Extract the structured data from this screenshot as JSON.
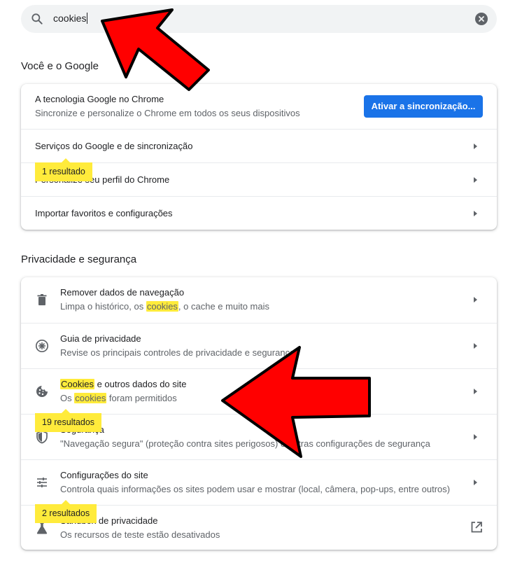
{
  "search": {
    "value": "cookies"
  },
  "sections": {
    "google": {
      "title": "Você e o Google",
      "sync_row": {
        "title": "A tecnologia Google no Chrome",
        "subtitle": "Sincronize e personalize o Chrome em todos os seus dispositivos",
        "button": "Ativar a sincronização..."
      },
      "rows": [
        {
          "title": "Serviços do Google e de sincronização"
        },
        {
          "title": "Personalize seu perfil do Chrome"
        },
        {
          "title": "Importar favoritos e configurações"
        }
      ],
      "bubble": "1 resultado"
    },
    "privacy": {
      "title": "Privacidade e segurança",
      "rows": [
        {
          "title": "Remover dados de navegação",
          "sub_a": "Limpa o histórico, os ",
          "sub_hl": "cookies",
          "sub_b": ", o cache e muito mais",
          "icon": "trash-icon"
        },
        {
          "title": "Guia de privacidade",
          "subtitle": "Revise os principais controles de privacidade e segurança",
          "icon": "compass-icon"
        },
        {
          "title_hl": "Cookies",
          "title_rest": " e outros dados do site",
          "sub_a": "Os ",
          "sub_hl": "cookies",
          "sub_b": " foram permitidos",
          "icon": "cookie-icon"
        },
        {
          "title": "Segurança",
          "subtitle": "\"Navegação segura\" (proteção contra sites perigosos) e outras configurações de segurança",
          "icon": "shield-icon"
        },
        {
          "title": "Configurações do site",
          "subtitle": "Controla quais informações os sites podem usar e mostrar (local, câmera, pop-ups, entre outros)",
          "icon": "tune-icon"
        },
        {
          "title": "Sandbox de privacidade",
          "subtitle": "Os recursos de teste estão desativados",
          "icon": "flask-icon",
          "trailing_icon": "open-in-new-icon"
        }
      ],
      "bubble_cookies": "19 resultados",
      "bubble_site": "2 resultados"
    }
  },
  "colors": {
    "accent": "#1a73e8",
    "highlight": "#ffeb3b",
    "annotation_arrow": "#ff0000"
  }
}
